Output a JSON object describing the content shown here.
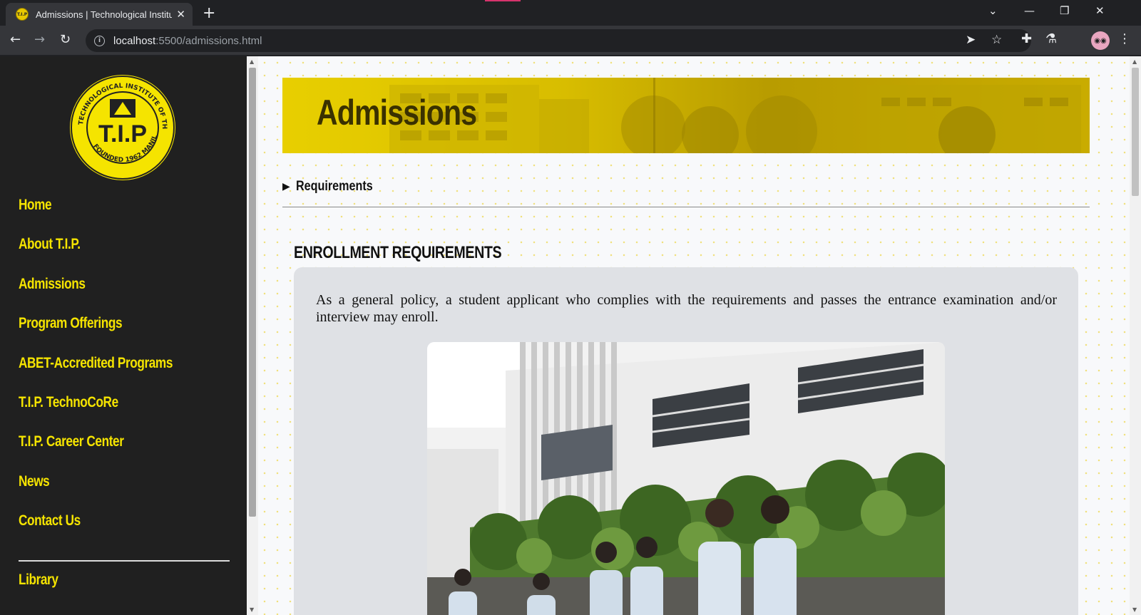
{
  "browser": {
    "tab_title": "Admissions | Technological Institu",
    "tab_favicon_text": "T.I.P",
    "new_tab": "+",
    "close_tab": "✕",
    "url_host": "localhost",
    "url_rest": ":5500/admissions.html",
    "window_controls": {
      "tab_search": "⌄",
      "minimize": "—",
      "restore": "❐",
      "close": "✕"
    },
    "nav": {
      "back": "←",
      "forward": "→",
      "reload": "↻"
    },
    "icons": [
      "send-tab-icon",
      "bookmark-star-icon",
      "extensions-icon",
      "labs-flask-icon",
      "profile-avatar",
      "menu-kebab-icon"
    ]
  },
  "sidebar": {
    "logo": {
      "ring_text_top": "TECHNOLOGICAL INSTITUTE OF THE PHILIPPINES",
      "ring_text_bottom": "FOUNDED 1962 MANILA",
      "center_text": "T.I.P"
    },
    "items": [
      {
        "label": "Home"
      },
      {
        "label": "About T.I.P."
      },
      {
        "label": "Admissions"
      },
      {
        "label": "Program Offerings"
      },
      {
        "label": "ABET-Accredited Programs"
      },
      {
        "label": "T.I.P. TechnoCoRe"
      },
      {
        "label": "T.I.P. Career Center"
      },
      {
        "label": "News"
      },
      {
        "label": "Contact Us"
      }
    ],
    "extra_items": [
      {
        "label": "Library"
      }
    ]
  },
  "main": {
    "banner_title": "Admissions",
    "requirements_toggle": "Requirements",
    "section_title": "ENROLLMENT REQUIREMENTS",
    "policy_text": "As a general policy, a student applicant who complies with the requirements and passes the entrance examination and/or interview may enroll."
  },
  "colors": {
    "sidebar_bg": "#202020",
    "nav_text": "#f5e400",
    "banner_yellow": "#e8cf00",
    "card_bg": "#dfe1e5",
    "page_bg": "#f8f9fb"
  }
}
